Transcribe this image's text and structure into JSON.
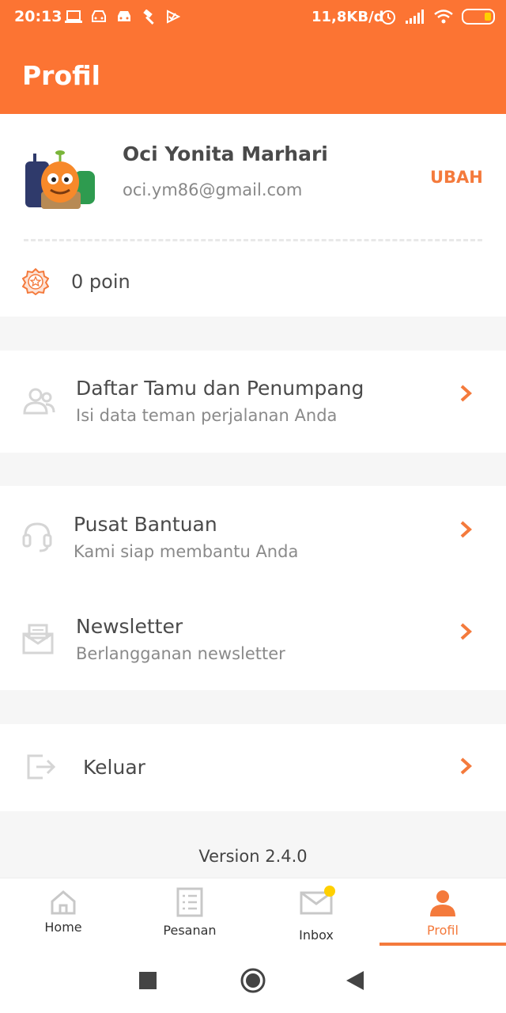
{
  "status_bar": {
    "time": "20:13",
    "net_speed": "11,8KB/d",
    "icons": [
      "laptop-icon",
      "car-icon",
      "car-icon",
      "hammer-icon",
      "check-flag-icon"
    ],
    "right_icons": [
      "alarm-icon",
      "signal-icon",
      "wifi-icon",
      "battery-icon"
    ]
  },
  "app_bar": {
    "title": "Profil"
  },
  "profile": {
    "name": "Oci Yonita Marhari",
    "email": "oci.ym86@gmail.com",
    "edit_label": "UBAH",
    "points": "0 poin"
  },
  "menu": {
    "guests": {
      "title": "Daftar Tamu dan Penumpang",
      "subtitle": "Isi data teman perjalanan Anda",
      "icon": "people-icon"
    },
    "help": {
      "title": "Pusat Bantuan",
      "subtitle": "Kami siap membantu Anda",
      "icon": "headset-icon"
    },
    "newsletter": {
      "title": "Newsletter",
      "subtitle": "Berlangganan newsletter",
      "icon": "mail-open-icon"
    },
    "logout": {
      "title": "Keluar",
      "icon": "logout-icon"
    }
  },
  "version": "Version 2.4.0",
  "bottom_nav": {
    "items": [
      {
        "label": "Home",
        "icon": "home-icon"
      },
      {
        "label": "Pesanan",
        "icon": "orders-icon"
      },
      {
        "label": "Inbox",
        "icon": "inbox-icon"
      },
      {
        "label": "Profil",
        "icon": "person-icon"
      }
    ],
    "active": "Profil"
  },
  "colors": {
    "brand": "#fc7433",
    "accent": "#f47a3c",
    "notification_dot": "#ffd000"
  }
}
